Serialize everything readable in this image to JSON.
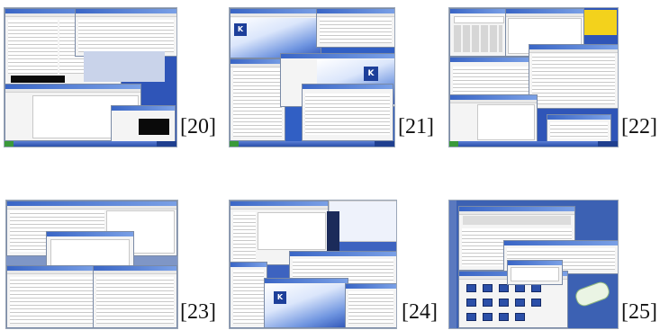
{
  "figures": [
    {
      "caption": "[20]"
    },
    {
      "caption": "[21]"
    },
    {
      "caption": "[22]"
    },
    {
      "caption": "[23]"
    },
    {
      "caption": "[24]"
    },
    {
      "caption": "[25]"
    }
  ],
  "colors": {
    "desktop_blue": "#2f55b8",
    "window_titlebar": "#3a66c6",
    "window_body": "#f4f4f4",
    "taskbar": "#2b4fa8"
  }
}
